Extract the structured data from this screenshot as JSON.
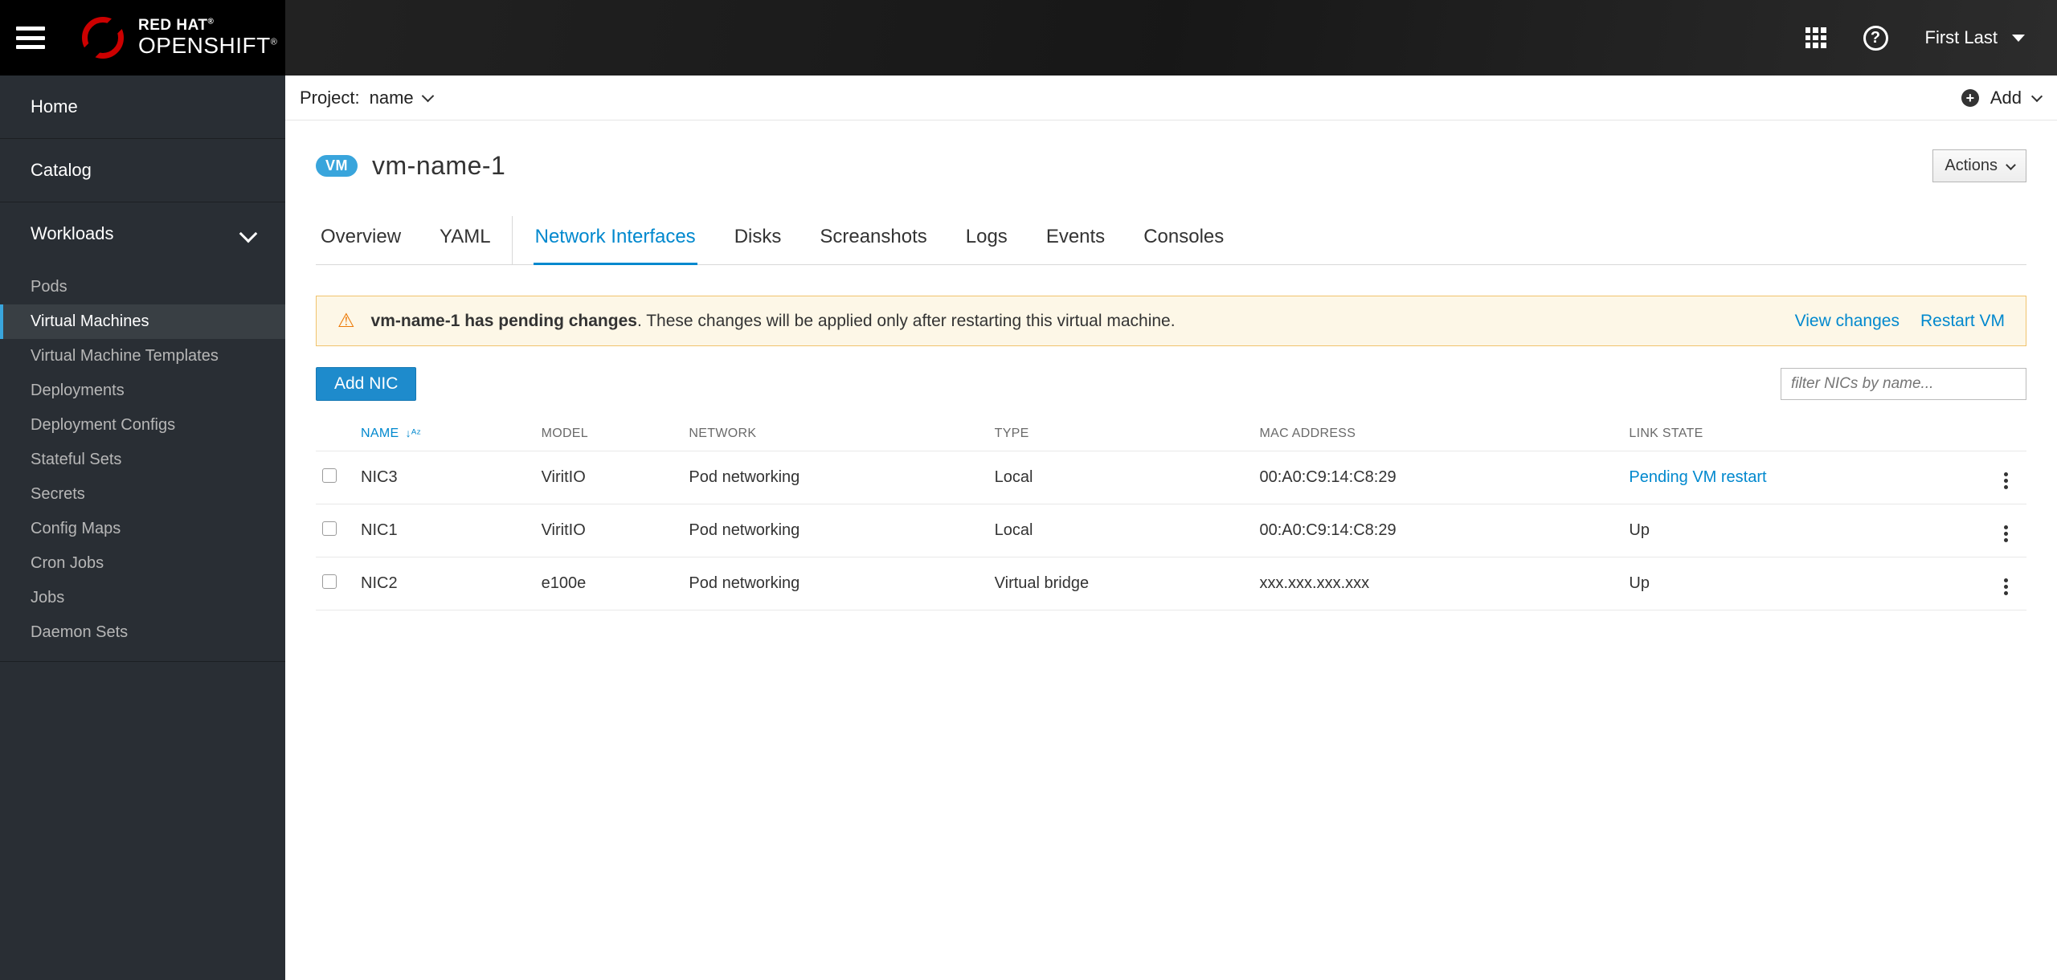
{
  "brand": {
    "line1": "RED HAT",
    "line2": "OPENSHIFT"
  },
  "user": {
    "name": "First Last"
  },
  "sidebar": {
    "home": "Home",
    "catalog": "Catalog",
    "workloads": "Workloads",
    "items": [
      "Pods",
      "Virtual Machines",
      "Virtual Machine Templates",
      "Deployments",
      "Deployment Configs",
      "Stateful Sets",
      "Secrets",
      "Config Maps",
      "Cron Jobs",
      "Jobs",
      "Daemon Sets"
    ],
    "active_index": 1
  },
  "projectbar": {
    "label": "Project:",
    "name": "name",
    "add": "Add"
  },
  "page": {
    "badge": "VM",
    "title": "vm-name-1",
    "actions": "Actions"
  },
  "tabs": [
    "Overview",
    "YAML",
    "Network Interfaces",
    "Disks",
    "Screanshots",
    "Logs",
    "Events",
    "Consoles"
  ],
  "active_tab": 2,
  "alert": {
    "bold": "vm-name-1 has pending changes",
    "rest": ". These changes will be applied only after restarting this virtual machine.",
    "view": "View changes",
    "restart": "Restart VM"
  },
  "buttons": {
    "add_nic": "Add NIC"
  },
  "filter_placeholder": "filter NICs by name...",
  "columns": [
    "NAME",
    "MODEL",
    "NETWORK",
    "TYPE",
    "MAC ADDRESS",
    "LINK STATE"
  ],
  "rows": [
    {
      "name": "NIC3",
      "model": "ViritIO",
      "network": "Pod networking",
      "type": "Local",
      "mac": "00:A0:C9:14:C8:29",
      "link": "Pending VM restart",
      "link_is_link": true
    },
    {
      "name": "NIC1",
      "model": "ViritIO",
      "network": "Pod networking",
      "type": "Local",
      "mac": "00:A0:C9:14:C8:29",
      "link": "Up",
      "link_is_link": false
    },
    {
      "name": "NIC2",
      "model": "e100e",
      "network": "Pod networking",
      "type": "Virtual bridge",
      "mac": "xxx.xxx.xxx.xxx",
      "link": "Up",
      "link_is_link": false
    }
  ]
}
